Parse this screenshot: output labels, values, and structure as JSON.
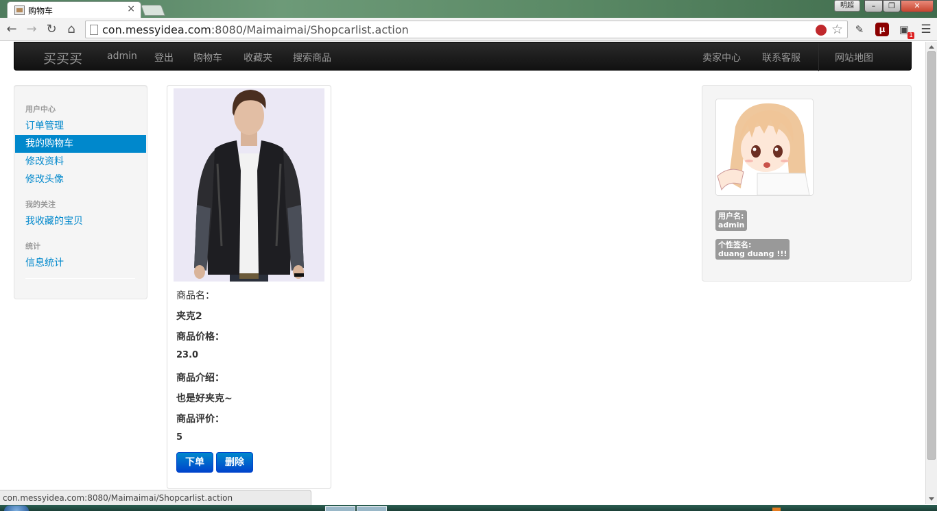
{
  "browser": {
    "tab_title": "购物车",
    "tab_close": "×",
    "profile_name": "明超",
    "url_host": "con.messyidea.com",
    "url_rest": ":8080/Maimaimai/Shopcarlist.action",
    "window_buttons": {
      "minimize": "–",
      "maximize": "❐",
      "close": "✕"
    },
    "nav": {
      "back": "←",
      "forward": "→",
      "reload": "↻",
      "home": "⌂"
    },
    "menu_icon": "☰",
    "star_icon": "☆",
    "ext_badge_count": "1"
  },
  "topnav": {
    "brand": "买买买",
    "links": [
      "admin",
      "登出",
      "购物车",
      "收藏夹",
      "搜索商品"
    ],
    "right_links": [
      "卖家中心",
      "联系客服",
      "网站地图"
    ]
  },
  "sidebar": {
    "sections": [
      {
        "header": "用户中心",
        "items": [
          "订单管理",
          "我的购物车",
          "修改资料",
          "修改头像"
        ]
      },
      {
        "header": "我的关注",
        "items": [
          "我收藏的宝贝"
        ]
      },
      {
        "header": "统计",
        "items": [
          "信息统计"
        ]
      }
    ],
    "active_item": "我的购物车"
  },
  "product": {
    "name_label": "商品名：",
    "name": "夹克2",
    "price_label": "商品价格：",
    "price": "23.0",
    "intro_label": "商品介绍：",
    "intro": "也是好夹克~",
    "rating_label": "商品评价：",
    "rating": "5",
    "order_button": "下单",
    "delete_button": "删除"
  },
  "profile": {
    "username_label": "用户名:",
    "username": "admin",
    "signature_label": "个性签名:",
    "signature": "duang duang !!!"
  },
  "status_bar": "con.messyidea.com:8080/Maimaimai/Shopcarlist.action",
  "colors": {
    "link": "#0088cc",
    "active_bg": "#0088cc",
    "navbar": "#1b1b1b",
    "button": "#0055cc"
  }
}
